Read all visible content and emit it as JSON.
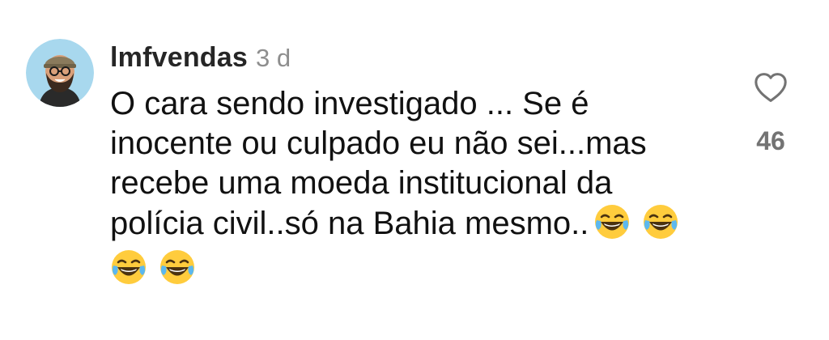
{
  "comment": {
    "username": "lmfvendas",
    "time": "3 d",
    "text": "O cara sendo investigado ... Se é inocente ou culpado eu não sei...mas recebe uma moeda institucional da polícia civil..só na Bahia mesmo..",
    "emojis": [
      "😂",
      "😂",
      "😂",
      "😂"
    ],
    "like_count": "46"
  },
  "icons": {
    "like": "heart-outline-icon",
    "avatar": "profile-avatar",
    "emoji": "face-with-tears-of-joy"
  },
  "colors": {
    "username": "#262626",
    "time": "#8e8e8e",
    "text": "#111111",
    "like_count": "#737373",
    "avatar_bg": "#a8d8ee"
  }
}
